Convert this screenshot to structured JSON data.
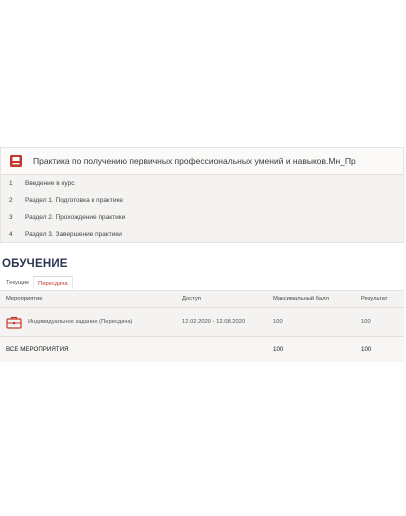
{
  "course": {
    "title": "Практика по получению первичных профессиональных умений и навыков.Мн_Пр",
    "icon": "book-icon",
    "sections": [
      {
        "num": "1",
        "label": "Введение в курс"
      },
      {
        "num": "2",
        "label": "Раздел 1. Подготовка к практике"
      },
      {
        "num": "3",
        "label": "Раздел 2. Прохождение практики"
      },
      {
        "num": "4",
        "label": "Раздел 3. Завершение практики"
      }
    ]
  },
  "learning": {
    "title": "ОБУЧЕНИЕ",
    "tabs": {
      "current": "Текущие",
      "retake": "Пересдача"
    }
  },
  "table": {
    "headers": {
      "event": "Мероприятие",
      "access": "Доступ",
      "max_score": "Максимальный балл",
      "result": "Результат"
    },
    "rows": [
      {
        "icon": "briefcase-icon",
        "event": "Индивидуальное задание (Пересдача)",
        "access": "12.02.2020 - 12.08.2020",
        "max_score": "100",
        "result": "100"
      }
    ],
    "total": {
      "label": "ВСЕ МЕРОПРИЯТИЯ",
      "max_score": "100",
      "result": "100"
    }
  },
  "colors": {
    "accent_red": "#c0392b",
    "title_navy": "#2b3551"
  }
}
